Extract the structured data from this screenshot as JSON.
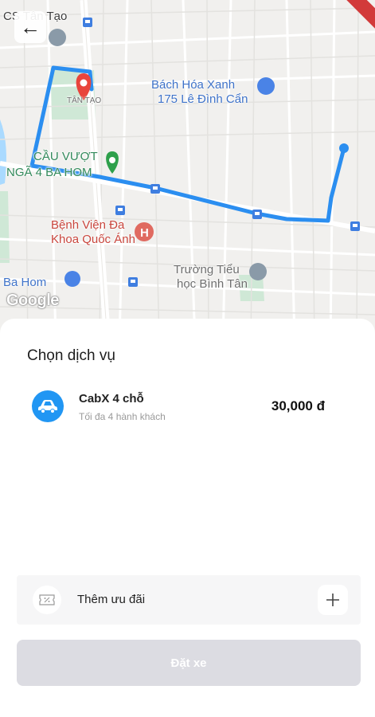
{
  "map": {
    "labels": {
      "top_left": "CS Tân Tạo",
      "tan_tao": "TÂN TẠO",
      "bach_hoa_1": "Bách Hóa Xanh",
      "bach_hoa_2": "175 Lê Đình Cẩn",
      "cau_vuot_1": "CẦU VƯỢT",
      "cau_vuot_2": "NGÃ 4 BA HOM",
      "benh_vien_1": "Bệnh Viện Đa",
      "benh_vien_2": "Khoa Quốc Ánh",
      "truong_1": "Trường Tiểu",
      "truong_2": "học Bình Tân",
      "ba_hom": "Ba Hom",
      "google": "Google"
    },
    "route_color": "#2b8ef0",
    "pin_color": "#e8453c"
  },
  "back_icon": "arrow-left-icon",
  "sheet": {
    "title": "Chọn dịch vụ",
    "service": {
      "icon": "car-icon",
      "name": "CabX 4 chỗ",
      "subtitle": "Tối đa 4 hành khách",
      "price": "30,000 đ",
      "accent": "#2196f3"
    },
    "promo": {
      "icon": "ticket-icon",
      "label": "Thêm ưu đãi",
      "add_icon": "plus-icon"
    },
    "book_button": {
      "label": "Đặt xe",
      "bg": "#dcdce2"
    }
  }
}
